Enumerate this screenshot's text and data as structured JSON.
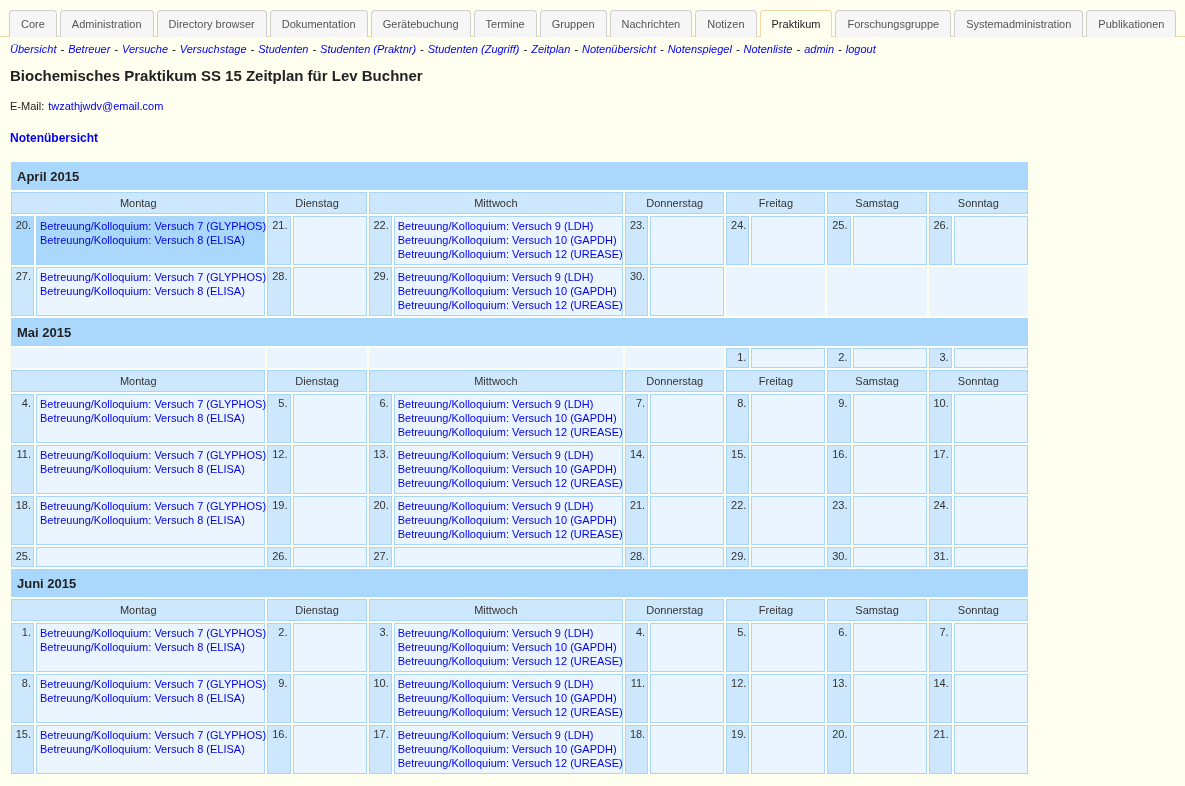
{
  "tabs": [
    {
      "label": "Core",
      "selected": false
    },
    {
      "label": "Administration",
      "selected": false
    },
    {
      "label": "Directory browser",
      "selected": false
    },
    {
      "label": "Dokumentation",
      "selected": false
    },
    {
      "label": "Gerätebuchung",
      "selected": false
    },
    {
      "label": "Termine",
      "selected": false
    },
    {
      "label": "Gruppen",
      "selected": false
    },
    {
      "label": "Nachrichten",
      "selected": false
    },
    {
      "label": "Notizen",
      "selected": false
    },
    {
      "label": "Praktikum",
      "selected": true
    },
    {
      "label": "Forschungsgruppe",
      "selected": false
    },
    {
      "label": "Systemadministration",
      "selected": false
    },
    {
      "label": "Publikationen",
      "selected": false
    }
  ],
  "nav": {
    "separator": "-",
    "links": [
      "Übersicht",
      "Betreuer",
      "Versuche",
      "Versuchstage",
      "Studenten",
      "Studenten (Praktnr)",
      "Studenten (Zugriff)",
      "Zeitplan",
      "Notenübersicht",
      "Notenspiegel",
      "Notenliste",
      "admin",
      "logout"
    ]
  },
  "title": "Biochemisches Praktikum SS 15 Zeitplan für Lev Buchner",
  "email": {
    "label": "E-Mail:",
    "address": "twzathjwdv@email.com"
  },
  "grades_link": "Notenübersicht",
  "months": [
    {
      "title": "April 2015",
      "sections": [
        {
          "kind": "weekdays",
          "labels": [
            "Montag",
            "Dienstag",
            "Mittwoch",
            "Donnerstag",
            "Freitag",
            "Samstag",
            "Sonntag"
          ]
        },
        {
          "kind": "week",
          "days": [
            {
              "kind": "day",
              "day": "20.",
              "today": true,
              "events": [
                "Betreuung/Kolloquium: Versuch 7 (GLYPHOS)",
                "Betreuung/Kolloquium: Versuch 8 (ELISA)"
              ]
            },
            {
              "kind": "day",
              "day": "21.",
              "today": false
            },
            {
              "kind": "day",
              "day": "22.",
              "today": false,
              "events": [
                "Betreuung/Kolloquium: Versuch 9 (LDH)",
                "Betreuung/Kolloquium: Versuch 10 (GAPDH)",
                "Betreuung/Kolloquium: Versuch 12 (UREASE)"
              ]
            },
            {
              "kind": "day",
              "day": "23.",
              "today": false
            },
            {
              "kind": "day",
              "day": "24.",
              "today": false
            },
            {
              "kind": "day",
              "day": "25.",
              "today": false
            },
            {
              "kind": "day",
              "day": "26.",
              "today": false
            }
          ]
        },
        {
          "kind": "week",
          "days": [
            {
              "kind": "day",
              "day": "27.",
              "today": false,
              "events": [
                "Betreuung/Kolloquium: Versuch 7 (GLYPHOS)",
                "Betreuung/Kolloquium: Versuch 8 (ELISA)"
              ]
            },
            {
              "kind": "day",
              "day": "28.",
              "today": false
            },
            {
              "kind": "day",
              "day": "29.",
              "today": false,
              "events": [
                "Betreuung/Kolloquium: Versuch 9 (LDH)",
                "Betreuung/Kolloquium: Versuch 10 (GAPDH)",
                "Betreuung/Kolloquium: Versuch 12 (UREASE)"
              ]
            },
            {
              "kind": "day",
              "day": "30.",
              "today": false
            },
            {
              "kind": "blank"
            },
            {
              "kind": "blank"
            },
            {
              "kind": "blank"
            }
          ]
        }
      ]
    },
    {
      "title": "Mai 2015",
      "sections": [
        {
          "kind": "week",
          "days": [
            {
              "kind": "blank"
            },
            {
              "kind": "blank"
            },
            {
              "kind": "blank"
            },
            {
              "kind": "blank"
            },
            {
              "kind": "day",
              "day": "1.",
              "today": false
            },
            {
              "kind": "day",
              "day": "2.",
              "today": false
            },
            {
              "kind": "day",
              "day": "3.",
              "today": false
            }
          ]
        },
        {
          "kind": "weekdays",
          "labels": [
            "Montag",
            "Dienstag",
            "Mittwoch",
            "Donnerstag",
            "Freitag",
            "Samstag",
            "Sonntag"
          ]
        },
        {
          "kind": "week",
          "days": [
            {
              "kind": "day",
              "day": "4.",
              "today": false,
              "events": [
                "Betreuung/Kolloquium: Versuch 7 (GLYPHOS)",
                "Betreuung/Kolloquium: Versuch 8 (ELISA)"
              ]
            },
            {
              "kind": "day",
              "day": "5.",
              "today": false
            },
            {
              "kind": "day",
              "day": "6.",
              "today": false,
              "events": [
                "Betreuung/Kolloquium: Versuch 9 (LDH)",
                "Betreuung/Kolloquium: Versuch 10 (GAPDH)",
                "Betreuung/Kolloquium: Versuch 12 (UREASE)"
              ]
            },
            {
              "kind": "day",
              "day": "7.",
              "today": false
            },
            {
              "kind": "day",
              "day": "8.",
              "today": false
            },
            {
              "kind": "day",
              "day": "9.",
              "today": false
            },
            {
              "kind": "day",
              "day": "10.",
              "today": false
            }
          ]
        },
        {
          "kind": "week",
          "days": [
            {
              "kind": "day",
              "day": "11.",
              "today": false,
              "events": [
                "Betreuung/Kolloquium: Versuch 7 (GLYPHOS)",
                "Betreuung/Kolloquium: Versuch 8 (ELISA)"
              ]
            },
            {
              "kind": "day",
              "day": "12.",
              "today": false
            },
            {
              "kind": "day",
              "day": "13.",
              "today": false,
              "events": [
                "Betreuung/Kolloquium: Versuch 9 (LDH)",
                "Betreuung/Kolloquium: Versuch 10 (GAPDH)",
                "Betreuung/Kolloquium: Versuch 12 (UREASE)"
              ]
            },
            {
              "kind": "day",
              "day": "14.",
              "today": false
            },
            {
              "kind": "day",
              "day": "15.",
              "today": false
            },
            {
              "kind": "day",
              "day": "16.",
              "today": false
            },
            {
              "kind": "day",
              "day": "17.",
              "today": false
            }
          ]
        },
        {
          "kind": "week",
          "days": [
            {
              "kind": "day",
              "day": "18.",
              "today": false,
              "events": [
                "Betreuung/Kolloquium: Versuch 7 (GLYPHOS)",
                "Betreuung/Kolloquium: Versuch 8 (ELISA)"
              ]
            },
            {
              "kind": "day",
              "day": "19.",
              "today": false
            },
            {
              "kind": "day",
              "day": "20.",
              "today": false,
              "events": [
                "Betreuung/Kolloquium: Versuch 9 (LDH)",
                "Betreuung/Kolloquium: Versuch 10 (GAPDH)",
                "Betreuung/Kolloquium: Versuch 12 (UREASE)"
              ]
            },
            {
              "kind": "day",
              "day": "21.",
              "today": false
            },
            {
              "kind": "day",
              "day": "22.",
              "today": false
            },
            {
              "kind": "day",
              "day": "23.",
              "today": false
            },
            {
              "kind": "day",
              "day": "24.",
              "today": false
            }
          ]
        },
        {
          "kind": "week",
          "days": [
            {
              "kind": "day",
              "day": "25.",
              "today": false
            },
            {
              "kind": "day",
              "day": "26.",
              "today": false
            },
            {
              "kind": "day",
              "day": "27.",
              "today": false
            },
            {
              "kind": "day",
              "day": "28.",
              "today": false
            },
            {
              "kind": "day",
              "day": "29.",
              "today": false
            },
            {
              "kind": "day",
              "day": "30.",
              "today": false
            },
            {
              "kind": "day",
              "day": "31.",
              "today": false
            }
          ]
        }
      ]
    },
    {
      "title": "Juni 2015",
      "sections": [
        {
          "kind": "weekdays",
          "labels": [
            "Montag",
            "Dienstag",
            "Mittwoch",
            "Donnerstag",
            "Freitag",
            "Samstag",
            "Sonntag"
          ]
        },
        {
          "kind": "week",
          "days": [
            {
              "kind": "day",
              "day": "1.",
              "today": false,
              "events": [
                "Betreuung/Kolloquium: Versuch 7 (GLYPHOS)",
                "Betreuung/Kolloquium: Versuch 8 (ELISA)"
              ]
            },
            {
              "kind": "day",
              "day": "2.",
              "today": false
            },
            {
              "kind": "day",
              "day": "3.",
              "today": false,
              "events": [
                "Betreuung/Kolloquium: Versuch 9 (LDH)",
                "Betreuung/Kolloquium: Versuch 10 (GAPDH)",
                "Betreuung/Kolloquium: Versuch 12 (UREASE)"
              ]
            },
            {
              "kind": "day",
              "day": "4.",
              "today": false
            },
            {
              "kind": "day",
              "day": "5.",
              "today": false
            },
            {
              "kind": "day",
              "day": "6.",
              "today": false
            },
            {
              "kind": "day",
              "day": "7.",
              "today": false
            }
          ]
        },
        {
          "kind": "week",
          "days": [
            {
              "kind": "day",
              "day": "8.",
              "today": false,
              "events": [
                "Betreuung/Kolloquium: Versuch 7 (GLYPHOS)",
                "Betreuung/Kolloquium: Versuch 8 (ELISA)"
              ]
            },
            {
              "kind": "day",
              "day": "9.",
              "today": false
            },
            {
              "kind": "day",
              "day": "10.",
              "today": false,
              "events": [
                "Betreuung/Kolloquium: Versuch 9 (LDH)",
                "Betreuung/Kolloquium: Versuch 10 (GAPDH)",
                "Betreuung/Kolloquium: Versuch 12 (UREASE)"
              ]
            },
            {
              "kind": "day",
              "day": "11.",
              "today": false
            },
            {
              "kind": "day",
              "day": "12.",
              "today": false
            },
            {
              "kind": "day",
              "day": "13.",
              "today": false
            },
            {
              "kind": "day",
              "day": "14.",
              "today": false
            }
          ]
        },
        {
          "kind": "week",
          "days": [
            {
              "kind": "day",
              "day": "15.",
              "today": false,
              "events": [
                "Betreuung/Kolloquium: Versuch 7 (GLYPHOS)",
                "Betreuung/Kolloquium: Versuch 8 (ELISA)"
              ]
            },
            {
              "kind": "day",
              "day": "16.",
              "today": false
            },
            {
              "kind": "day",
              "day": "17.",
              "today": false,
              "events": [
                "Betreuung/Kolloquium: Versuch 9 (LDH)",
                "Betreuung/Kolloquium: Versuch 10 (GAPDH)",
                "Betreuung/Kolloquium: Versuch 12 (UREASE)"
              ]
            },
            {
              "kind": "day",
              "day": "18.",
              "today": false
            },
            {
              "kind": "day",
              "day": "19.",
              "today": false
            },
            {
              "kind": "day",
              "day": "20.",
              "today": false
            },
            {
              "kind": "day",
              "day": "21.",
              "today": false
            }
          ]
        }
      ]
    }
  ]
}
